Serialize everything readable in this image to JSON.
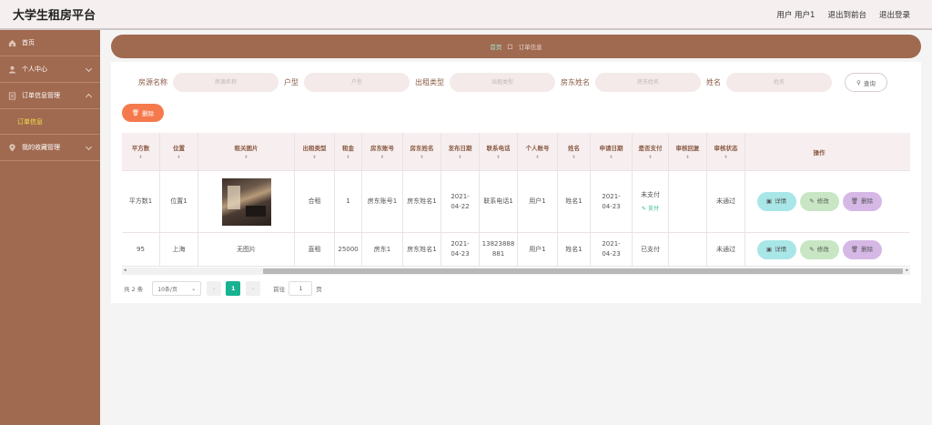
{
  "header": {
    "title": "大学生租房平台",
    "user_label": "用户 用户1",
    "front_link": "退出到前台",
    "logout_link": "退出登录"
  },
  "sidebar": {
    "items": [
      {
        "label": "首页",
        "icon": "home-icon"
      },
      {
        "label": "个人中心",
        "icon": "user-icon"
      },
      {
        "label": "订单信息管理",
        "icon": "document-icon"
      },
      {
        "label": "我的收藏管理",
        "icon": "location-pin-icon"
      }
    ],
    "active_sub": "订单信息"
  },
  "breadcrumb": {
    "home": "首页",
    "current": "订单信息"
  },
  "search": {
    "fields": [
      {
        "label": "房源名称",
        "placeholder": "房源名称"
      },
      {
        "label": "户型",
        "placeholder": "户型"
      },
      {
        "label": "出租类型",
        "placeholder": "出租类型"
      },
      {
        "label": "房东姓名",
        "placeholder": "房东姓名"
      },
      {
        "label": "姓名",
        "placeholder": "姓名"
      }
    ],
    "query_label": "查询",
    "delete_label": "删除"
  },
  "table": {
    "headers": [
      "平方数",
      "位置",
      "租关图片",
      "出租类型",
      "租金",
      "房东账号",
      "房东姓名",
      "发布日期",
      "联系电话",
      "个人账号",
      "姓名",
      "申请日期",
      "是否支付",
      "审核回复",
      "审核状态",
      "操作"
    ],
    "rows": [
      {
        "area": "平方数1",
        "location": "位置1",
        "image": "",
        "rent_type": "合租",
        "rent": "1",
        "landlord_account": "房东账号1",
        "landlord_name": "房东姓名1",
        "publish_date": "2021-04-22",
        "phone": "联系电话1",
        "personal_account": "用户1",
        "name": "姓名1",
        "apply_date": "2021-04-23",
        "paid": "未支付",
        "pay_action": "支付",
        "review_reply": "",
        "review_status": "未通过"
      },
      {
        "area": "95",
        "location": "上海",
        "image": "无图片",
        "rent_type": "直租",
        "rent": "25000",
        "landlord_account": "房东1",
        "landlord_name": "房东姓名1",
        "publish_date": "2021-04-23",
        "phone": "13823888881",
        "personal_account": "用户1",
        "name": "姓名1",
        "apply_date": "2021-04-23",
        "paid": "已支付",
        "pay_action": "",
        "review_reply": "",
        "review_status": "未通过"
      }
    ],
    "actions": {
      "detail": "详情",
      "edit": "修改",
      "delete": "删除"
    }
  },
  "pagination": {
    "total": "共 2 条",
    "page_size": "10条/页",
    "current_page": "1",
    "goto_label": "前往",
    "goto_value": "1",
    "page_suffix": "页"
  },
  "colors": {
    "brand": "#a06a50",
    "accent_green": "#17b390",
    "delete_orange": "#f47a4e"
  }
}
